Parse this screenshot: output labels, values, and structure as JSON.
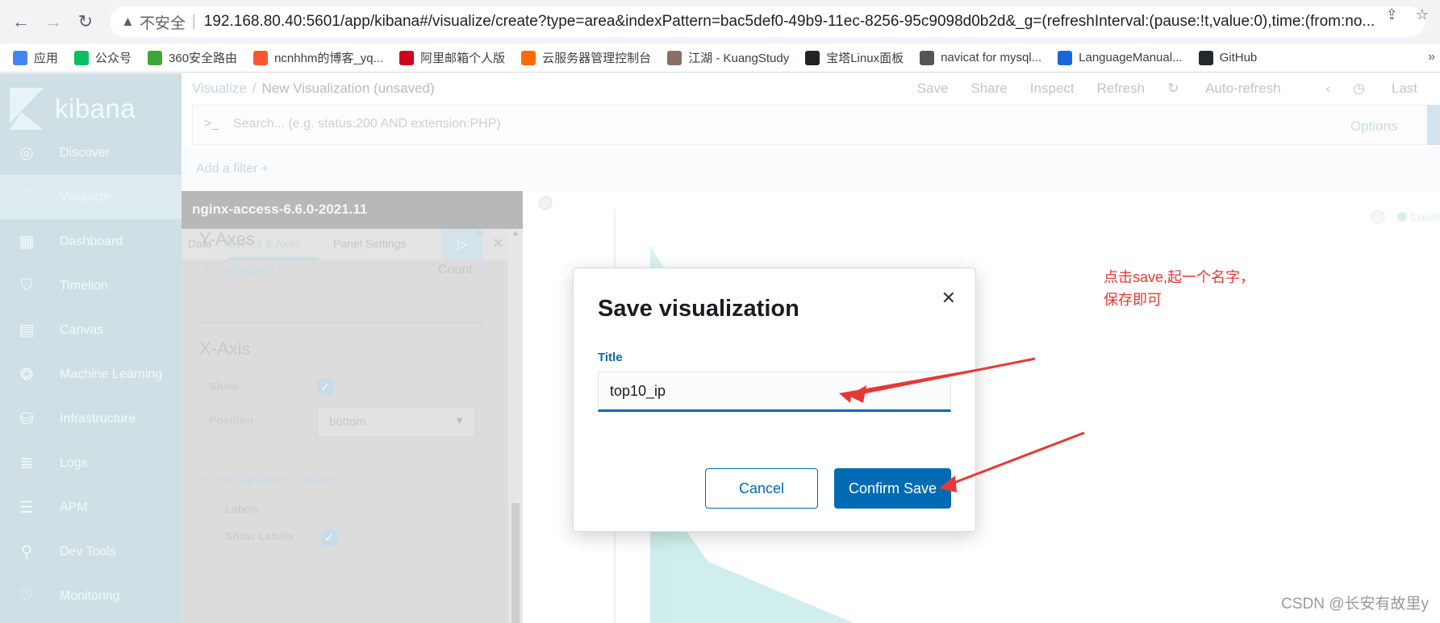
{
  "browser": {
    "insecure_label": "不安全",
    "url": "192.168.80.40:5601/app/kibana#/visualize/create?type=area&indexPattern=bac5def0-49b9-11ec-8256-95c9098d0b2d&_g=(refreshInterval:(pause:!t,value:0),time:(from:no...",
    "bookmarks": [
      {
        "label": "应用",
        "icon": "apps-icon",
        "color": "#4285f4"
      },
      {
        "label": "公众号",
        "icon": "wechat-icon",
        "color": "#07c160"
      },
      {
        "label": "360安全路由",
        "icon": "plus-circle-icon",
        "color": "#3fa535"
      },
      {
        "label": "ncnhhm的博客_yq...",
        "icon": "csdn-icon",
        "color": "#fc5531"
      },
      {
        "label": "阿里邮箱个人版",
        "icon": "mail-icon",
        "color": "#d0021b"
      },
      {
        "label": "云服务器管理控制台",
        "icon": "cloud-icon",
        "color": "#ff6a00"
      },
      {
        "label": "江湖 - KuangStudy",
        "icon": "avatar-icon",
        "color": "#8d6e63"
      },
      {
        "label": "宝塔Linux面板",
        "icon": "bt-icon",
        "color": "#222222"
      },
      {
        "label": "navicat for mysql...",
        "icon": "navicat-icon",
        "color": "#555555"
      },
      {
        "label": "LanguageManual...",
        "icon": "confluence-icon",
        "color": "#1868db"
      },
      {
        "label": "GitHub",
        "icon": "github-icon",
        "color": "#24292e"
      }
    ],
    "more_label": "»"
  },
  "kibana": {
    "logo_text": "kibana",
    "nav": [
      {
        "label": "Discover",
        "icon": "compass-icon"
      },
      {
        "label": "Visualize",
        "icon": "visualize-icon"
      },
      {
        "label": "Dashboard",
        "icon": "dashboard-icon"
      },
      {
        "label": "Timelion",
        "icon": "timelion-icon"
      },
      {
        "label": "Canvas",
        "icon": "canvas-icon"
      },
      {
        "label": "Machine Learning",
        "icon": "ml-icon"
      },
      {
        "label": "Infrastructure",
        "icon": "infrastructure-icon"
      },
      {
        "label": "Logs",
        "icon": "logs-icon"
      },
      {
        "label": "APM",
        "icon": "apm-icon"
      },
      {
        "label": "Dev Tools",
        "icon": "wrench-icon"
      },
      {
        "label": "Monitoring",
        "icon": "heartbeat-icon"
      }
    ],
    "breadcrumb": {
      "root": "Visualize",
      "separator": "/",
      "current": "New Visualization (unsaved)"
    },
    "top_actions": {
      "save": "Save",
      "share": "Share",
      "inspect": "Inspect",
      "refresh": "Refresh",
      "auto_refresh": "Auto-refresh",
      "last": "Last"
    },
    "search": {
      "prompt": ">_",
      "placeholder": "Search... (e.g. status:200 AND extension:PHP)",
      "options": "Options"
    },
    "add_filter": "Add a filter +",
    "editor": {
      "index_pattern": "nginx-access-6.6.0-2021.11",
      "tabs": [
        "Data",
        "Metrics & Axes",
        "Panel Settings"
      ],
      "y_axes": "Y-Axes",
      "left_axis": "LeftAxis-1",
      "count": "Count",
      "x_axis": "X-Axis",
      "show": "Show",
      "position": "Position",
      "position_value": "bottom",
      "hide_advanced": "Hide Advanced Options",
      "labels": "Labels",
      "show_labels": "Show Labels"
    },
    "legend": "Count"
  },
  "modal": {
    "title": "Save visualization",
    "field_label": "Title",
    "field_value": "top10_ip",
    "cancel": "Cancel",
    "confirm": "Confirm Save"
  },
  "annotation": {
    "line1": "点击save,起一个名字，",
    "line2": "保存即可",
    "color": "#e53935"
  },
  "watermark": "CSDN @长安有故里y",
  "colors": {
    "kibana_primary": "#006bb4",
    "sidebar_bg": "#cfdfe6",
    "area_fill": "#d9f3f1"
  }
}
